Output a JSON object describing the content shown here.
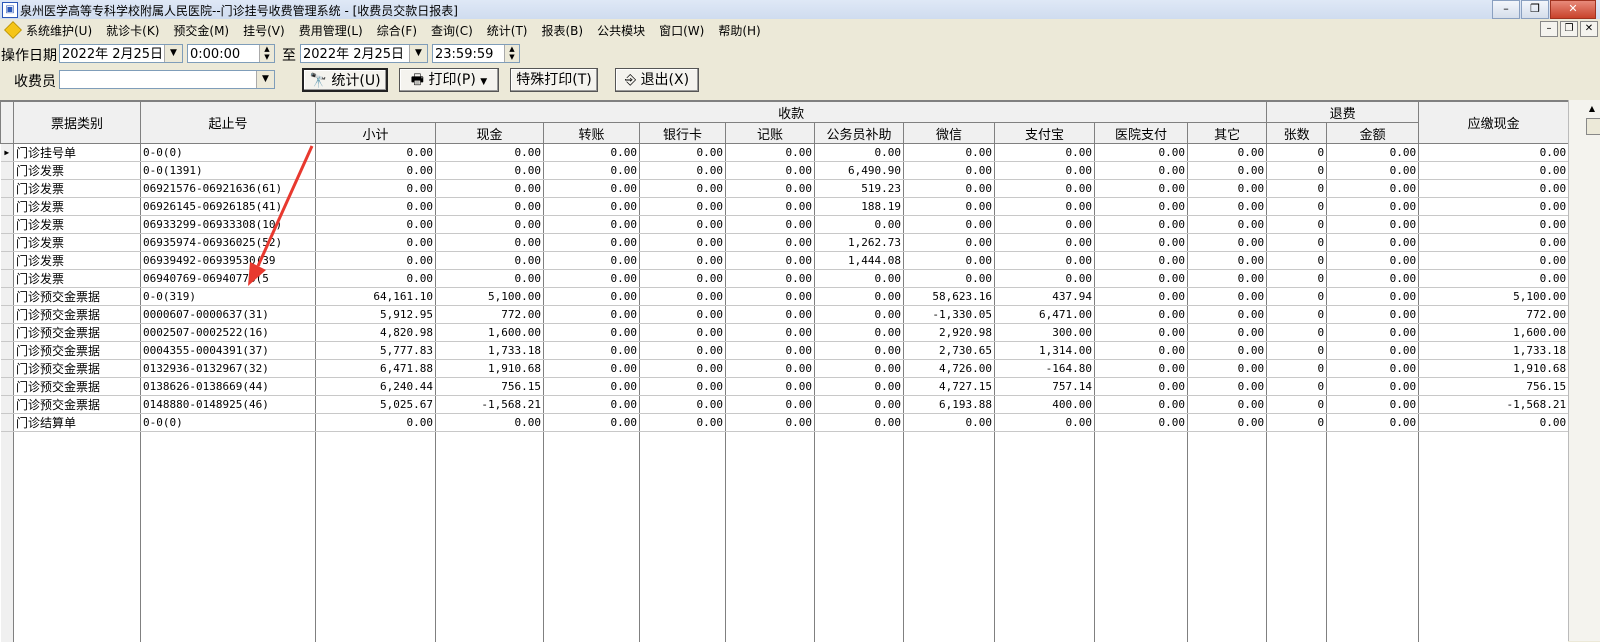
{
  "window": {
    "title": "泉州医学高等专科学校附属人民医院--门诊挂号收费管理系统 - [收费员交款日报表]",
    "buttons": [
      "–",
      "❐",
      "✕"
    ]
  },
  "menu": [
    "系统维护(U)",
    "就诊卡(K)",
    "预交金(M)",
    "挂号(V)",
    "费用管理(L)",
    "综合(F)",
    "查询(C)",
    "统计(T)",
    "报表(B)",
    "公共模块",
    "窗口(W)",
    "帮助(H)"
  ],
  "mdi_buttons": [
    "–",
    "❐",
    "✕"
  ],
  "filters": {
    "date_label": "操作日期",
    "start_date": "2022年 2月25日",
    "start_time": "0:00:00",
    "to_label": "至",
    "end_date": "2022年 2月25日",
    "end_time": "23:59:59",
    "cashier_label": "收费员",
    "cashier_value": ""
  },
  "buttons": {
    "stats": "统计(U)",
    "print": "打印(P)",
    "special_print": "特殊打印(T)",
    "exit": "退出(X)"
  },
  "table": {
    "group_headers": {
      "shoukuan": "收款",
      "tuifei": "退费"
    },
    "headers": [
      "票据类别",
      "起止号",
      "小计",
      "现金",
      "转账",
      "银行卡",
      "记账",
      "公务员补助",
      "微信",
      "支付宝",
      "医院支付",
      "其它",
      "张数",
      "金额",
      "应缴现金"
    ],
    "rows": [
      [
        "门诊挂号单",
        "0-0(0)",
        "0.00",
        "0.00",
        "0.00",
        "0.00",
        "0.00",
        "0.00",
        "0.00",
        "0.00",
        "0.00",
        "0.00",
        "0",
        "0.00",
        "0.00"
      ],
      [
        "门诊发票",
        "0-0(1391)",
        "0.00",
        "0.00",
        "0.00",
        "0.00",
        "0.00",
        "6,490.90",
        "0.00",
        "0.00",
        "0.00",
        "0.00",
        "0",
        "0.00",
        "0.00"
      ],
      [
        "门诊发票",
        "06921576-06921636(61)",
        "0.00",
        "0.00",
        "0.00",
        "0.00",
        "0.00",
        "519.23",
        "0.00",
        "0.00",
        "0.00",
        "0.00",
        "0",
        "0.00",
        "0.00"
      ],
      [
        "门诊发票",
        "06926145-06926185(41)",
        "0.00",
        "0.00",
        "0.00",
        "0.00",
        "0.00",
        "188.19",
        "0.00",
        "0.00",
        "0.00",
        "0.00",
        "0",
        "0.00",
        "0.00"
      ],
      [
        "门诊发票",
        "06933299-06933308(10)",
        "0.00",
        "0.00",
        "0.00",
        "0.00",
        "0.00",
        "0.00",
        "0.00",
        "0.00",
        "0.00",
        "0.00",
        "0",
        "0.00",
        "0.00"
      ],
      [
        "门诊发票",
        "06935974-06936025(52)",
        "0.00",
        "0.00",
        "0.00",
        "0.00",
        "0.00",
        "1,262.73",
        "0.00",
        "0.00",
        "0.00",
        "0.00",
        "0",
        "0.00",
        "0.00"
      ],
      [
        "门诊发票",
        "06939492-06939530(39",
        "0.00",
        "0.00",
        "0.00",
        "0.00",
        "0.00",
        "1,444.08",
        "0.00",
        "0.00",
        "0.00",
        "0.00",
        "0",
        "0.00",
        "0.00"
      ],
      [
        "门诊发票",
        "06940769-06940773(5",
        "0.00",
        "0.00",
        "0.00",
        "0.00",
        "0.00",
        "0.00",
        "0.00",
        "0.00",
        "0.00",
        "0.00",
        "0",
        "0.00",
        "0.00"
      ],
      [
        "门诊预交金票据",
        "0-0(319)",
        "64,161.10",
        "5,100.00",
        "0.00",
        "0.00",
        "0.00",
        "0.00",
        "58,623.16",
        "437.94",
        "0.00",
        "0.00",
        "0",
        "0.00",
        "5,100.00"
      ],
      [
        "门诊预交金票据",
        "0000607-0000637(31)",
        "5,912.95",
        "772.00",
        "0.00",
        "0.00",
        "0.00",
        "0.00",
        "-1,330.05",
        "6,471.00",
        "0.00",
        "0.00",
        "0",
        "0.00",
        "772.00"
      ],
      [
        "门诊预交金票据",
        "0002507-0002522(16)",
        "4,820.98",
        "1,600.00",
        "0.00",
        "0.00",
        "0.00",
        "0.00",
        "2,920.98",
        "300.00",
        "0.00",
        "0.00",
        "0",
        "0.00",
        "1,600.00"
      ],
      [
        "门诊预交金票据",
        "0004355-0004391(37)",
        "5,777.83",
        "1,733.18",
        "0.00",
        "0.00",
        "0.00",
        "0.00",
        "2,730.65",
        "1,314.00",
        "0.00",
        "0.00",
        "0",
        "0.00",
        "1,733.18"
      ],
      [
        "门诊预交金票据",
        "0132936-0132967(32)",
        "6,471.88",
        "1,910.68",
        "0.00",
        "0.00",
        "0.00",
        "0.00",
        "4,726.00",
        "-164.80",
        "0.00",
        "0.00",
        "0",
        "0.00",
        "1,910.68"
      ],
      [
        "门诊预交金票据",
        "0138626-0138669(44)",
        "6,240.44",
        "756.15",
        "0.00",
        "0.00",
        "0.00",
        "0.00",
        "4,727.15",
        "757.14",
        "0.00",
        "0.00",
        "0",
        "0.00",
        "756.15"
      ],
      [
        "门诊预交金票据",
        "0148880-0148925(46)",
        "5,025.67",
        "-1,568.21",
        "0.00",
        "0.00",
        "0.00",
        "0.00",
        "6,193.88",
        "400.00",
        "0.00",
        "0.00",
        "0",
        "0.00",
        "-1,568.21"
      ],
      [
        "门诊结算单",
        "0-0(0)",
        "0.00",
        "0.00",
        "0.00",
        "0.00",
        "0.00",
        "0.00",
        "0.00",
        "0.00",
        "0.00",
        "0.00",
        "0",
        "0.00",
        "0.00"
      ]
    ]
  },
  "colors": {
    "annotation_arrow": "#e8392f",
    "title_bar": "#cfdcef",
    "window_bg": "#ece9d8"
  }
}
